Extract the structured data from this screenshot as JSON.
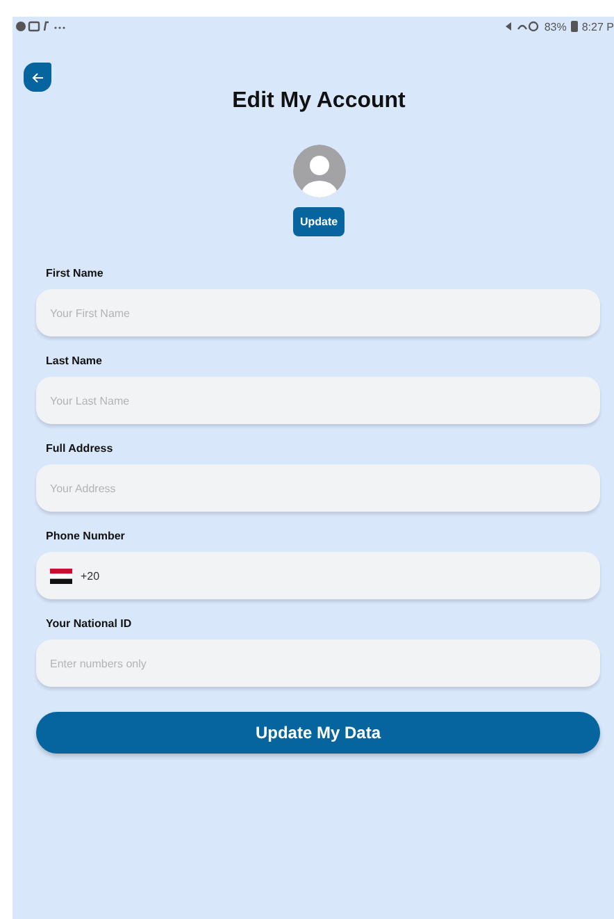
{
  "status_bar": {
    "battery": "83%",
    "time": "8:27 P"
  },
  "header": {
    "title": "Edit My Account"
  },
  "avatar": {
    "button": "Update"
  },
  "fields": [
    {
      "kind": "text",
      "label": "First Name",
      "placeholder": "Your First Name"
    },
    {
      "kind": "text",
      "label": "Last Name",
      "placeholder": "Your Last Name"
    },
    {
      "kind": "text",
      "label": "Full Address",
      "placeholder": "Your Address"
    },
    {
      "kind": "phone",
      "label": "Phone Number",
      "value": "+20"
    },
    {
      "kind": "text",
      "label": "Your National ID",
      "placeholder": "Enter numbers only"
    }
  ],
  "submit": "Update My Data"
}
